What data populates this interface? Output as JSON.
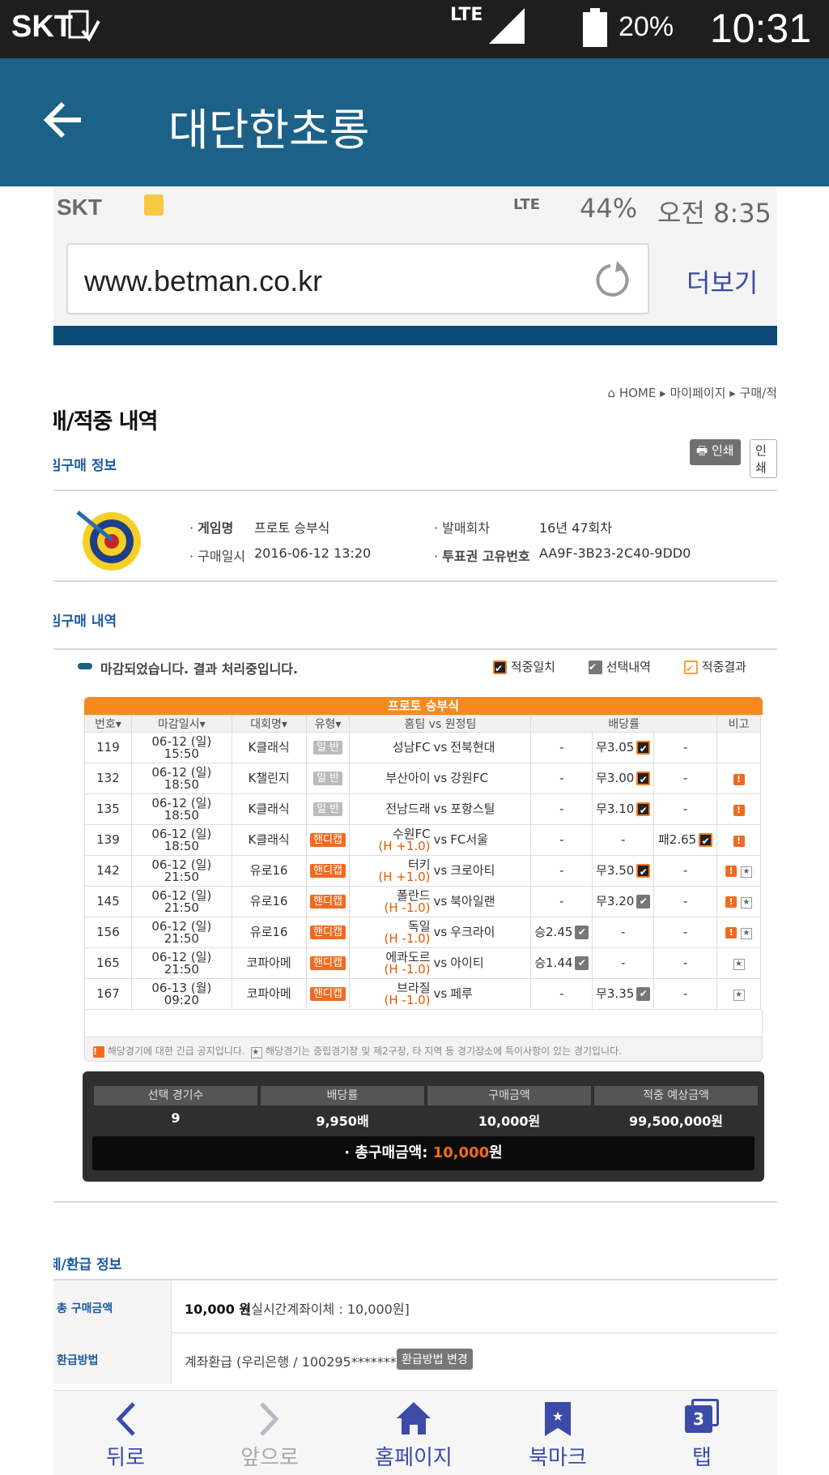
{
  "status_bar": {
    "carrier": "SKT",
    "battery": "20%",
    "time": "10:31",
    "network": "LTE"
  },
  "app_bar": {
    "title": "대단한초롱"
  },
  "inner_status": {
    "carrier": "SKT",
    "battery": "44%",
    "time": "오전 8:35",
    "network": "LTE"
  },
  "browser": {
    "url": "www.betman.co.kr",
    "more": "더보기"
  },
  "breadcrumb": {
    "home": "HOME",
    "mypage": "마이페이지",
    "current": "구매/적"
  },
  "page": {
    "title": "매/적중 내역",
    "print": "인쇄",
    "print2": "인쇄"
  },
  "game_info": {
    "section": "임구매 정보",
    "game_name_label": "게임명",
    "game_name": "프로토 승부식",
    "round_label": "발매회차",
    "round": "16년 47회차",
    "purchase_time_label": "구매일시",
    "purchase_time": "2016-06-12 13:20",
    "ticket_id_label": "투표권 고유번호",
    "ticket_id": "AA9F-3B23-2C40-9DD0"
  },
  "purchase_detail": {
    "section": "임구매 내역",
    "notice": "마감되었습니다. 결과 처리중입니다.",
    "legend": [
      "적중일치",
      "선택내역",
      "적중결과"
    ],
    "table_title": "프로토 승부식"
  },
  "table": {
    "headers": [
      "번호",
      "마감일시",
      "대회명",
      "유형",
      "홈팀 vs 원정팀",
      "배당률",
      "비고"
    ],
    "rows": [
      {
        "no": "119",
        "date": "06-12 (일)",
        "time": "15:50",
        "league": "K클래식",
        "type": "일 반",
        "home": "성남FC",
        "hc": "",
        "away": "전북현대",
        "win": "-",
        "draw": "무3.05",
        "lose": "-",
        "pick": "draw",
        "pick_sel": "o",
        "note_warn": false,
        "note_star": false
      },
      {
        "no": "132",
        "date": "06-12 (일)",
        "time": "18:50",
        "league": "K챌린지",
        "type": "일 반",
        "home": "부산아이",
        "hc": "",
        "away": "강원FC",
        "win": "-",
        "draw": "무3.00",
        "lose": "-",
        "pick": "draw",
        "pick_sel": "o",
        "note_warn": true,
        "note_star": false
      },
      {
        "no": "135",
        "date": "06-12 (일)",
        "time": "18:50",
        "league": "K클래식",
        "type": "일 반",
        "home": "전남드래",
        "hc": "",
        "away": "포항스틸",
        "win": "-",
        "draw": "무3.10",
        "lose": "-",
        "pick": "draw",
        "pick_sel": "o",
        "note_warn": true,
        "note_star": false
      },
      {
        "no": "139",
        "date": "06-12 (일)",
        "time": "18:50",
        "league": "K클래식",
        "type": "핸디캡",
        "home": "수원FC",
        "hc": "(H +1.0)",
        "away": "FC서울",
        "win": "-",
        "draw": "-",
        "lose": "패2.65",
        "pick": "lose",
        "pick_sel": "o",
        "note_warn": true,
        "note_star": false
      },
      {
        "no": "142",
        "date": "06-12 (일)",
        "time": "21:50",
        "league": "유로16",
        "type": "핸디캡",
        "home": "터키",
        "hc": "(H +1.0)",
        "away": "크로아티",
        "win": "-",
        "draw": "무3.50",
        "lose": "-",
        "pick": "draw",
        "pick_sel": "o",
        "note_warn": true,
        "note_star": true
      },
      {
        "no": "145",
        "date": "06-12 (일)",
        "time": "21:50",
        "league": "유로16",
        "type": "핸디캡",
        "home": "폴란드",
        "hc": "(H -1.0)",
        "away": "북아일랜",
        "win": "-",
        "draw": "무3.20",
        "lose": "-",
        "pick": "draw",
        "pick_sel": "g",
        "note_warn": true,
        "note_star": true
      },
      {
        "no": "156",
        "date": "06-12 (일)",
        "time": "21:50",
        "league": "유로16",
        "type": "핸디캡",
        "home": "독일",
        "hc": "(H -1.0)",
        "away": "우크라이",
        "win": "승2.45",
        "draw": "-",
        "lose": "-",
        "pick": "win",
        "pick_sel": "g",
        "note_warn": true,
        "note_star": true
      },
      {
        "no": "165",
        "date": "06-12 (일)",
        "time": "21:50",
        "league": "코파아메",
        "type": "핸디캡",
        "home": "에콰도르",
        "hc": "(H -1.0)",
        "away": "아이티",
        "win": "승1.44",
        "draw": "-",
        "lose": "-",
        "pick": "win",
        "pick_sel": "g",
        "note_warn": false,
        "note_star": true
      },
      {
        "no": "167",
        "date": "06-13 (월)",
        "time": "09:20",
        "league": "코파아메",
        "type": "핸디캡",
        "home": "브라질",
        "hc": "(H -1.0)",
        "away": "페루",
        "win": "-",
        "draw": "무3.35",
        "lose": "-",
        "pick": "draw",
        "pick_sel": "g",
        "note_warn": false,
        "note_star": true
      }
    ],
    "vs": "vs",
    "footnote_warn": "해당경기에 대한 긴급 공지입니다.",
    "footnote_star": "해당경기는 중립경기장 및 제2구장, 타 지역 등 경기장소에 특이사항이 있는 경기입니다."
  },
  "summary": {
    "labels": [
      "선택 경기수",
      "배당률",
      "구매금액",
      "적중 예상금액"
    ],
    "values": [
      "9",
      "9,950배",
      "10,000원",
      "99,500,000원"
    ],
    "total_label": "총구매금액:",
    "total_amount": "10,000",
    "total_unit": "원"
  },
  "payment": {
    "section": "제/환급 정보",
    "amount_label": "총 구매금액",
    "amount": "10,000 원",
    "amount_detail": "[실시간계좌이체 : 10,000원]",
    "refund_label": "환급방법",
    "refund": "계좌환급 (우리은행 / 100295*******)",
    "refund_change": "환급방법 변경"
  },
  "bottom_nav": {
    "back": "뒤로",
    "forward": "앞으로",
    "home": "홈페이지",
    "bookmark": "북마크",
    "tabs": "탭",
    "tab_count": "3"
  },
  "colors": {
    "appbar": "#1c6187",
    "accent_orange": "#f26a21",
    "link_blue": "#3b4ba8"
  }
}
